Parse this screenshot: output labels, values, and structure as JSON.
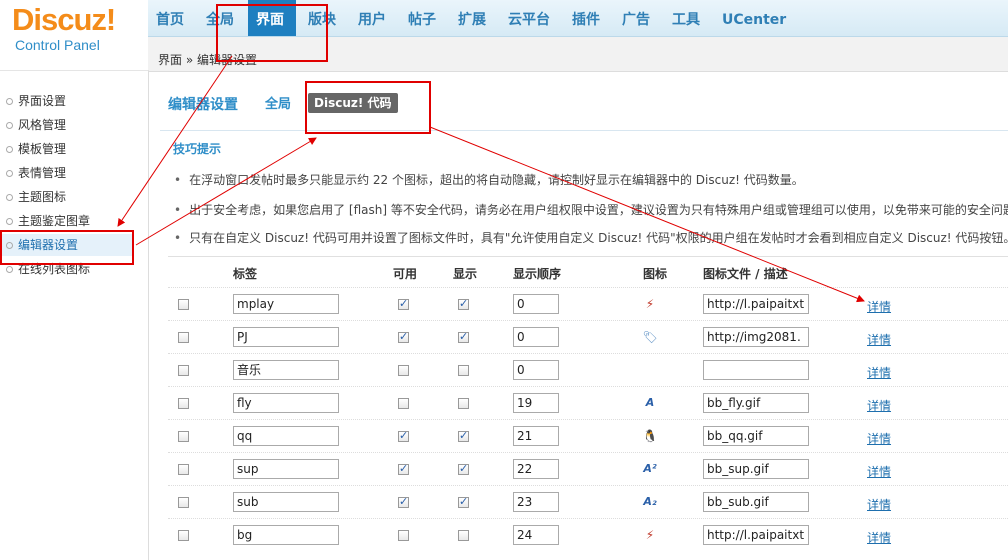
{
  "logo": {
    "main": "Discuz!",
    "sub": "Control Panel"
  },
  "nav": [
    "首页",
    "全局",
    "界面",
    "版块",
    "用户",
    "帖子",
    "扩展",
    "云平台",
    "插件",
    "广告",
    "工具",
    "UCenter"
  ],
  "nav_active_index": 2,
  "breadcrumb": "界面 » 编辑器设置",
  "sidebar": [
    "界面设置",
    "风格管理",
    "模板管理",
    "表情管理",
    "主题图标",
    "主题鉴定图章",
    "编辑器设置",
    "在线列表图标"
  ],
  "sidebar_active_index": 6,
  "page": {
    "title": "编辑器设置",
    "tab_global": "全局",
    "tab_code": "Discuz! 代码"
  },
  "tips": {
    "title": "技巧提示",
    "items": [
      "在浮动窗口发帖时最多只能显示约 22 个图标，超出的将自动隐藏，请控制好显示在编辑器中的 Discuz! 代码数量。",
      "出于安全考虑，如果您启用了 [flash] 等不安全代码，请务必在用户组权限中设置，建议设置为只有特殊用户组或管理组可以使用，以免带来可能的安全问题。",
      "只有在自定义 Discuz! 代码可用并设置了图标文件时，具有\"允许使用自定义 Discuz! 代码\"权限的用户组在发帖时才会看到相应自定义 Discuz! 代码按钮。"
    ]
  },
  "table": {
    "headers": [
      "标签",
      "可用",
      "显示",
      "显示顺序",
      "图标",
      "图标文件 / 描述"
    ],
    "detail_label": "详情",
    "rows": [
      {
        "tag": "mplay",
        "enabled": true,
        "shown": true,
        "order": "0",
        "icon": "flash-icon",
        "file": "http://l.paipaitxt"
      },
      {
        "tag": "PJ",
        "enabled": true,
        "shown": true,
        "order": "0",
        "icon": "tag-icon",
        "file": "http://img2081."
      },
      {
        "tag": "音乐",
        "enabled": false,
        "shown": false,
        "order": "0",
        "icon": "",
        "file": ""
      },
      {
        "tag": "fly",
        "enabled": false,
        "shown": false,
        "order": "19",
        "icon": "fly-text-icon",
        "file": "bb_fly.gif"
      },
      {
        "tag": "qq",
        "enabled": true,
        "shown": true,
        "order": "21",
        "icon": "qq-penguin-icon",
        "file": "bb_qq.gif"
      },
      {
        "tag": "sup",
        "enabled": true,
        "shown": true,
        "order": "22",
        "icon": "superscript-icon",
        "file": "bb_sup.gif"
      },
      {
        "tag": "sub",
        "enabled": true,
        "shown": true,
        "order": "23",
        "icon": "subscript-icon",
        "file": "bb_sub.gif"
      },
      {
        "tag": "bg",
        "enabled": false,
        "shown": false,
        "order": "24",
        "icon": "flash-icon",
        "file": "http://l.paipaitxt"
      }
    ]
  },
  "colors": {
    "accent": "#2f8ec8",
    "nav_active": "#1e7fc0",
    "logo": "#f48c1a",
    "annotation": "#e00000"
  }
}
